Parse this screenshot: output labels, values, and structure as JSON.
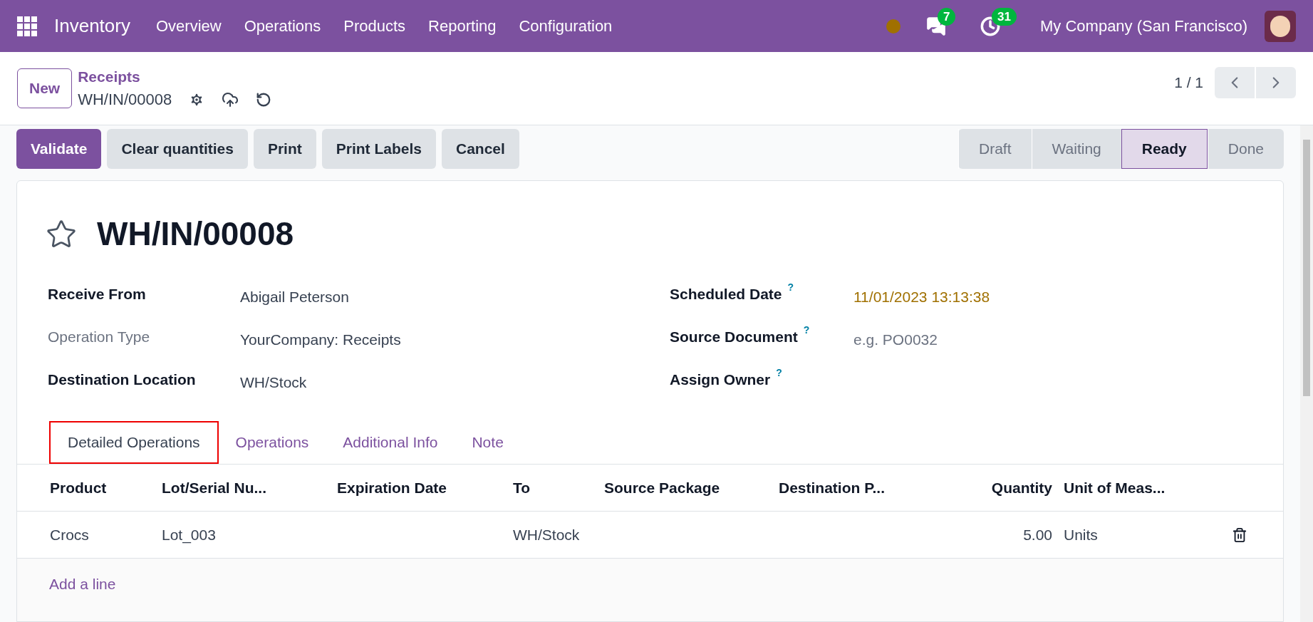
{
  "navbar": {
    "app_name": "Inventory",
    "menu": [
      "Overview",
      "Operations",
      "Products",
      "Reporting",
      "Configuration"
    ],
    "messages_badge": "7",
    "activities_badge": "31",
    "company": "My Company (San Francisco)"
  },
  "control_panel": {
    "new_button": "New",
    "breadcrumb_parent": "Receipts",
    "breadcrumb_current": "WH/IN/00008",
    "pager": "1 / 1"
  },
  "actions": [
    {
      "label": "Validate",
      "primary": true
    },
    {
      "label": "Clear quantities",
      "primary": false
    },
    {
      "label": "Print",
      "primary": false
    },
    {
      "label": "Print Labels",
      "primary": false
    },
    {
      "label": "Cancel",
      "primary": false
    }
  ],
  "status_steps": [
    {
      "label": "Draft",
      "selected": false
    },
    {
      "label": "Waiting",
      "selected": false
    },
    {
      "label": "Ready",
      "selected": true
    },
    {
      "label": "Done",
      "selected": false
    }
  ],
  "record": {
    "title": "WH/IN/00008",
    "starred": false
  },
  "fields_left": [
    {
      "label": "Receive From",
      "value": "Abigail Peterson",
      "readonly": false
    },
    {
      "label": "Operation Type",
      "value": "YourCompany: Receipts",
      "readonly": true
    },
    {
      "label": "Destination Location",
      "value": "WH/Stock",
      "readonly": false
    }
  ],
  "fields_right": [
    {
      "label": "Scheduled Date",
      "help": "?",
      "value": "11/01/2023 13:13:38",
      "late": true
    },
    {
      "label": "Source Document",
      "help": "?",
      "placeholder": "e.g. PO0032"
    },
    {
      "label": "Assign Owner",
      "help": "?"
    }
  ],
  "tabs": [
    {
      "label": "Detailed Operations",
      "selected": true
    },
    {
      "label": "Operations",
      "selected": false
    },
    {
      "label": "Additional Info",
      "selected": false
    },
    {
      "label": "Note",
      "selected": false
    }
  ],
  "table": {
    "columns": [
      {
        "label": "Product"
      },
      {
        "label": "Lot/Serial Nu..."
      },
      {
        "label": "Expiration Date"
      },
      {
        "label": "To"
      },
      {
        "label": "Source Package"
      },
      {
        "label": "Destination P..."
      },
      {
        "label": "Quantity",
        "numeric": true
      },
      {
        "label": "Unit of Meas..."
      }
    ],
    "rows": [
      {
        "cells": [
          "Crocs",
          "Lot_003",
          "",
          "WH/Stock",
          "",
          "",
          "5.00",
          "Units"
        ]
      }
    ],
    "add_line": "Add a line"
  }
}
